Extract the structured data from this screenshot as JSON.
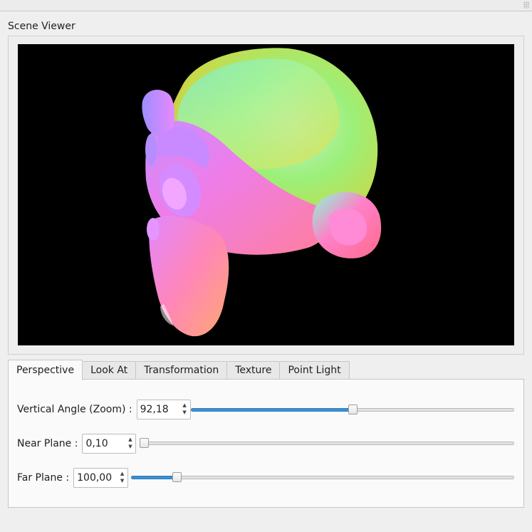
{
  "group": {
    "title": "Scene Viewer"
  },
  "viewport": {
    "background": "#000000",
    "object_icon": "suzanne-monkey-head-normals"
  },
  "tabs": [
    {
      "label": "Perspective",
      "active": true
    },
    {
      "label": "Look At",
      "active": false
    },
    {
      "label": "Transformation",
      "active": false
    },
    {
      "label": "Texture",
      "active": false
    },
    {
      "label": "Point Light",
      "active": false
    }
  ],
  "perspective": {
    "vertical_angle": {
      "label": "Vertical Angle (Zoom) :",
      "value": "92,18",
      "slider_fraction": 0.5
    },
    "near_plane": {
      "label": "Near Plane :",
      "value": "0,10",
      "slider_fraction": 0.0
    },
    "far_plane": {
      "label": "Far Plane :",
      "value": "100,00",
      "slider_fraction": 0.11
    }
  },
  "colors": {
    "accent": "#3d8fd1",
    "window": "#efefef",
    "panel": "#fafafa"
  }
}
